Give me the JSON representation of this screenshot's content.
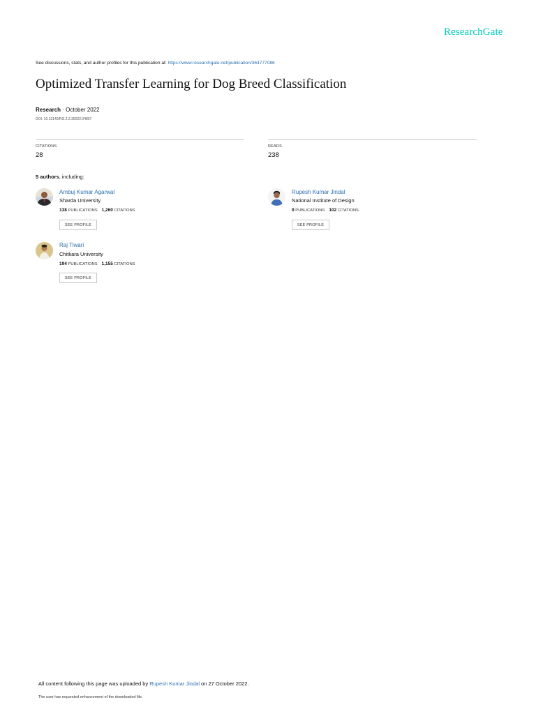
{
  "brand": {
    "logo_text": "ResearchGate",
    "accent_color": "#00ccbb",
    "link_color": "#2a6fb0"
  },
  "header": {
    "discussion_text": "See discussions, stats, and author profiles for this publication at: ",
    "publication_url": "https://www.researchgate.net/publication/364777086"
  },
  "publication": {
    "title": "Optimized Transfer Learning for Dog Breed Classification",
    "type": "Research",
    "date_separator": " · ",
    "date": "October 2022",
    "doi": "DOI: 10.13140/RG.2.2.35022.04807"
  },
  "stats": {
    "citations_label": "CITATIONS",
    "citations_value": "28",
    "reads_label": "READS",
    "reads_value": "238"
  },
  "authors_section": {
    "count_text": "5 authors",
    "suffix": ", including:"
  },
  "authors": [
    {
      "name": "Ambuj Kumar Agarwal",
      "institution": "Sharda University",
      "publications": "138",
      "publications_label": "PUBLICATIONS",
      "citations": "1,260",
      "citations_label": "CITATIONS",
      "button": "SEE PROFILE"
    },
    {
      "name": "Rupesh Kumar Jindal",
      "institution": "National Institute of Design",
      "publications": "9",
      "publications_label": "PUBLICATIONS",
      "citations": "102",
      "citations_label": "CITATIONS",
      "button": "SEE PROFILE"
    },
    {
      "name": "Raj Tiwari",
      "institution": "Chitkara University",
      "publications": "194",
      "publications_label": "PUBLICATIONS",
      "citations": "1,155",
      "citations_label": "CITATIONS",
      "button": "SEE PROFILE"
    }
  ],
  "footer": {
    "uploaded_prefix": "All content following this page was uploaded by ",
    "uploader": "Rupesh Kumar Jindal",
    "uploaded_suffix": " on 27 October 2022.",
    "enhancement_note": "The user has requested enhancement of the downloaded file."
  }
}
